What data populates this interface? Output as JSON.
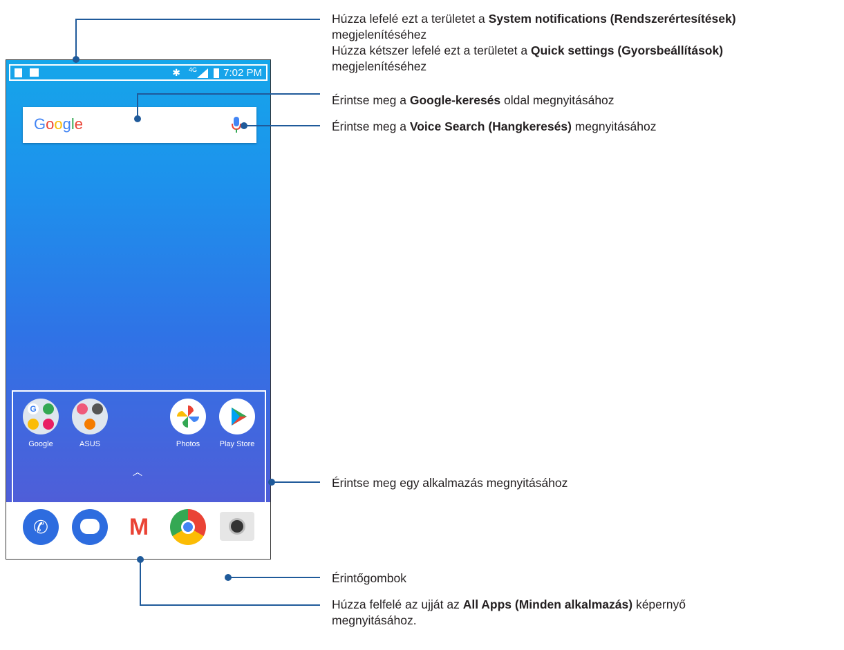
{
  "status_bar": {
    "time": "7:02 PM",
    "network": "4G"
  },
  "search_widget": {
    "logo": "Google"
  },
  "apps_row": [
    {
      "label": "Google",
      "icon": "google-folder-icon"
    },
    {
      "label": "ASUS",
      "icon": "asus-folder-icon"
    },
    {
      "label": "Photos",
      "icon": "photos-icon"
    },
    {
      "label": "Play Store",
      "icon": "play-store-icon"
    }
  ],
  "dock": [
    {
      "icon": "phone-icon"
    },
    {
      "icon": "messages-icon"
    },
    {
      "icon": "gmail-icon"
    },
    {
      "icon": "chrome-icon"
    },
    {
      "icon": "camera-icon"
    }
  ],
  "callouts": {
    "c1": {
      "pre": "Húzza lefelé ezt a területet a ",
      "bold": "System notifications (Rendszerértesítések)",
      "post": "megjelenítéséhez"
    },
    "c2": {
      "pre": "Húzza kétszer lefelé ezt a területet a ",
      "bold": "Quick settings (Gyorsbeállítások)",
      "post": "megjelenítéséhez"
    },
    "c3": {
      "pre": "Érintse meg a ",
      "bold": "Google-keresés",
      "post": " oldal megnyitásához"
    },
    "c4": {
      "pre": "Érintse meg a ",
      "bold": "Voice Search (Hangkeresés)",
      "post": " megnyitásához"
    },
    "c5": {
      "text": "Érintse meg egy alkalmazás megnyitásához"
    },
    "c6": {
      "text": "Érintőgombok"
    },
    "c7": {
      "pre": "Húzza felfelé az ujját az ",
      "bold": "All Apps (Minden alkalmazás)",
      "post": " képernyő",
      "line2": "megnyitásához."
    }
  },
  "colors": {
    "callout_line": "#1f5a9a",
    "wallpaper_top": "#15a6ea",
    "wallpaper_bottom": "#4f5ed8"
  }
}
